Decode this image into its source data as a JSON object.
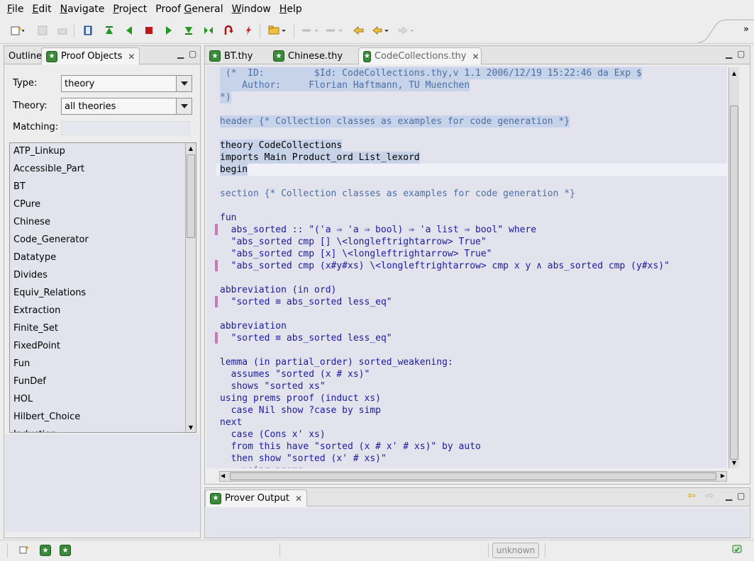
{
  "menubar": {
    "items": [
      {
        "label": "File",
        "u": "F",
        "rest": "ile"
      },
      {
        "label": "Edit",
        "u": "E",
        "rest": "dit"
      },
      {
        "label": "Navigate",
        "u": "N",
        "rest": "avigate"
      },
      {
        "label": "Project",
        "u": "P",
        "rest": "roject"
      },
      {
        "label": "Proof General",
        "u": "",
        "rest": "Proof General"
      },
      {
        "label": "Window",
        "u": "W",
        "rest": "indow"
      },
      {
        "label": "Help",
        "u": "H",
        "rest": "elp"
      }
    ]
  },
  "left_panel": {
    "tab_outline": "Outline",
    "tab_proof_objects": "Proof Objects",
    "type_label": "Type:",
    "type_value": "theory",
    "theory_label": "Theory:",
    "theory_value": "all theories",
    "matching_label": "Matching:",
    "items": [
      "ATP_Linkup",
      "Accessible_Part",
      "BT",
      "CPure",
      "Chinese",
      "Code_Generator",
      "Datatype",
      "Divides",
      "Equiv_Relations",
      "Extraction",
      "Finite_Set",
      "FixedPoint",
      "Fun",
      "FunDef",
      "HOL",
      "Hilbert_Choice",
      "Induction"
    ]
  },
  "editor": {
    "tabs": [
      "BT.thy",
      "Chinese.thy",
      "CodeCollections.thy"
    ],
    "lines": [
      " (*  ID:         $Id: CodeCollections.thy,v 1.1 2006/12/19 15:22:46 da Exp $",
      "    Author:     Florian Haftmann, TU Muenchen",
      "*)",
      "",
      "header {* Collection classes as examples for code generation *}",
      "",
      "theory CodeCollections",
      "imports Main Product_ord List_lexord",
      "begin",
      "",
      "section {* Collection classes as examples for code generation *}",
      "",
      "fun",
      "  abs_sorted :: \"('a ⇒ 'a ⇒ bool) ⇒ 'a list ⇒ bool\" where",
      "  \"abs_sorted cmp [] \\<longleftrightarrow> True\"",
      "  \"abs_sorted cmp [x] \\<longleftrightarrow> True\"",
      "  \"abs_sorted cmp (x#y#xs) \\<longleftrightarrow> cmp x y ∧ abs_sorted cmp (y#xs)\"",
      "",
      "abbreviation (in ord)",
      "  \"sorted ≡ abs_sorted less_eq\"",
      "",
      "abbreviation",
      "  \"sorted ≡ abs_sorted less_eq\"",
      "",
      "lemma (in partial_order) sorted_weakening:",
      "  assumes \"sorted (x # xs)\"",
      "  shows \"sorted xs\"",
      "using prems proof (induct xs)",
      "  case Nil show ?case by simp",
      "next",
      "  case (Cons x' xs)",
      "  from this have \"sorted (x # x' # xs)\" by auto",
      "  then show \"sorted (x' # xs)\"",
      "    using prems"
    ]
  },
  "output": {
    "tab": "Prover Output"
  },
  "status": {
    "unknown_label": "unknown"
  }
}
